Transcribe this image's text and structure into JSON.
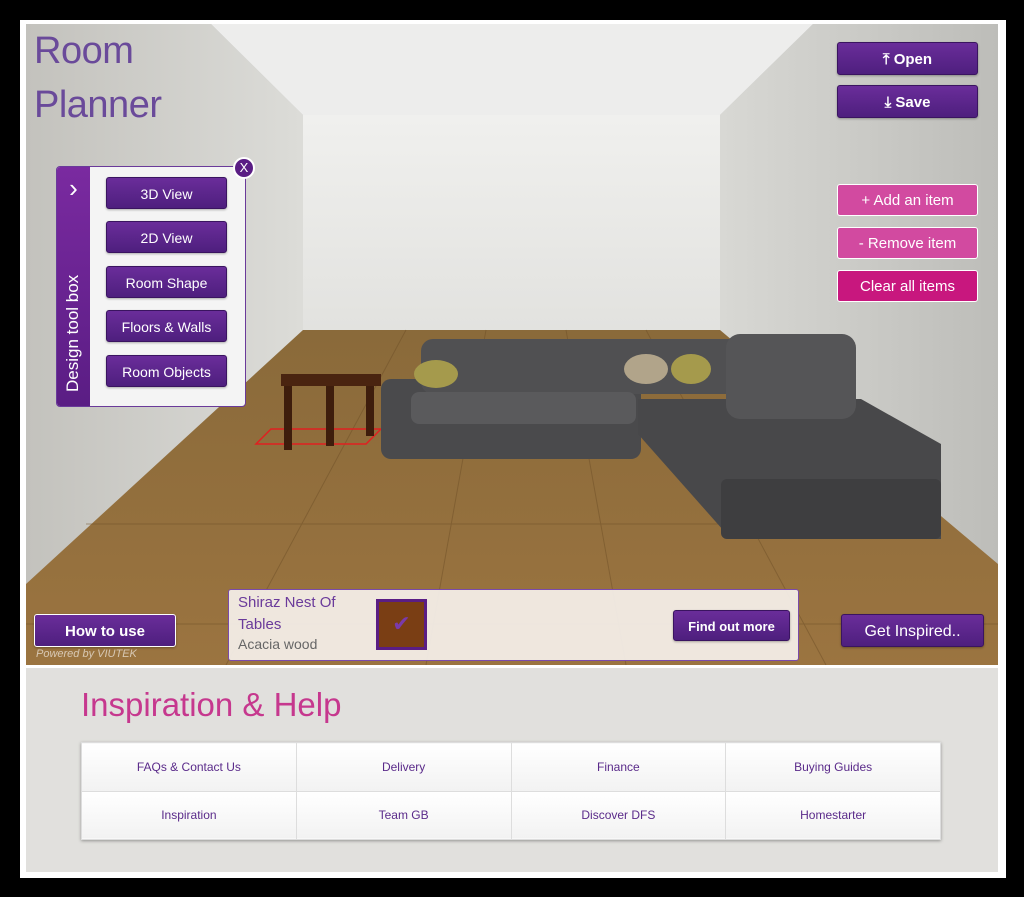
{
  "app": {
    "title_line1": "Room",
    "title_line2": "Planner",
    "powered_by": "Powered by VIUTEK"
  },
  "top_buttons": {
    "open": "⤒ Open",
    "save": "⤓ Save"
  },
  "item_buttons": {
    "add": "+ Add an item",
    "remove": "- Remove item",
    "clear": "Clear all items"
  },
  "toolbox": {
    "label": "Design tool box",
    "close": "X",
    "expand": "›",
    "items": [
      "3D View",
      "2D View",
      "Room Shape",
      "Floors & Walls",
      "Room Objects"
    ]
  },
  "product": {
    "name": "Shiraz Nest Of Tables",
    "material": "Acacia wood",
    "find_out_more": "Find out more",
    "swatch_color": "#7a3e14"
  },
  "bottom_buttons": {
    "how_to_use": "How to use",
    "get_inspired": "Get Inspired.."
  },
  "help": {
    "title": "Inspiration & Help",
    "rows": [
      [
        "FAQs & Contact Us",
        "Delivery",
        "Finance",
        "Buying Guides"
      ],
      [
        "Inspiration",
        "Team GB",
        "Discover DFS",
        "Homestarter"
      ]
    ]
  },
  "colors": {
    "primary": "#5a1d84",
    "pink": "#d24aa0",
    "magenta": "#c8177e",
    "heading": "#c6388e"
  }
}
